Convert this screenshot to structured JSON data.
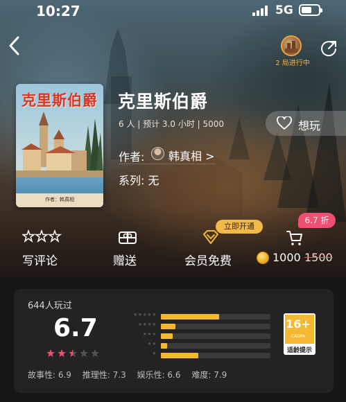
{
  "status_bar": {
    "time": "10:27",
    "network": "5G"
  },
  "header": {
    "games_in_progress": "2 局进行中"
  },
  "game": {
    "cover_title": "克里斯伯爵",
    "cover_credit": "作者：韩真相",
    "title": "克里斯伯爵",
    "meta": "6 人 | 预计 3.0 小时 | 5000",
    "author_label": "作者:",
    "author_name": "韩真相 >",
    "series": "系列: 无",
    "want_label": "想玩"
  },
  "actions": {
    "review": "写评论",
    "gift": "赠送",
    "member_free": "会员免费",
    "open_badge": "立即开通",
    "discount_badge": "6.7 折",
    "price": "1000",
    "original_price": "1500"
  },
  "rating": {
    "players": "644人玩过",
    "score": "6.7",
    "score_stars": 2.5,
    "distribution": [
      {
        "stars": 5,
        "fraction": 0.53
      },
      {
        "stars": 4,
        "fraction": 0.13
      },
      {
        "stars": 3,
        "fraction": 0.11
      },
      {
        "stars": 2,
        "fraction": 0.06
      },
      {
        "stars": 1,
        "fraction": 0.34
      }
    ],
    "age_badge": {
      "number": "16+",
      "org": "CADPA",
      "tip": "适龄提示"
    },
    "attributes": [
      {
        "text": "故事性:  6.9"
      },
      {
        "text": "推理性:  7.3"
      },
      {
        "text": "娱乐性:  6.6"
      },
      {
        "text": "难度:  7.9"
      }
    ]
  },
  "colors": {
    "accent": "#f4b832",
    "discount": "#ef4f72",
    "games_in_progress": "#f5b03c"
  }
}
